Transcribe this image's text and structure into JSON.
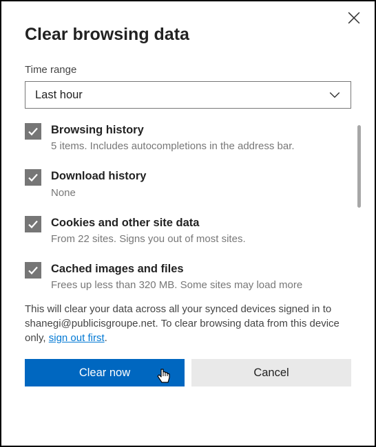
{
  "dialog": {
    "title": "Clear browsing data",
    "time_range_label": "Time range",
    "time_range_value": "Last hour"
  },
  "options": [
    {
      "title": "Browsing history",
      "desc": "5 items. Includes autocompletions in the address bar."
    },
    {
      "title": "Download history",
      "desc": "None"
    },
    {
      "title": "Cookies and other site data",
      "desc": "From 22 sites. Signs you out of most sites."
    },
    {
      "title": "Cached images and files",
      "desc": "Frees up less than 320 MB. Some sites may load more"
    }
  ],
  "notice": {
    "pre": "This will clear your data across all your synced devices signed in to shanegi@publicisgroupe.net. To clear browsing data from this device only, ",
    "link": "sign out first",
    "post": "."
  },
  "buttons": {
    "primary": "Clear now",
    "secondary": "Cancel"
  }
}
